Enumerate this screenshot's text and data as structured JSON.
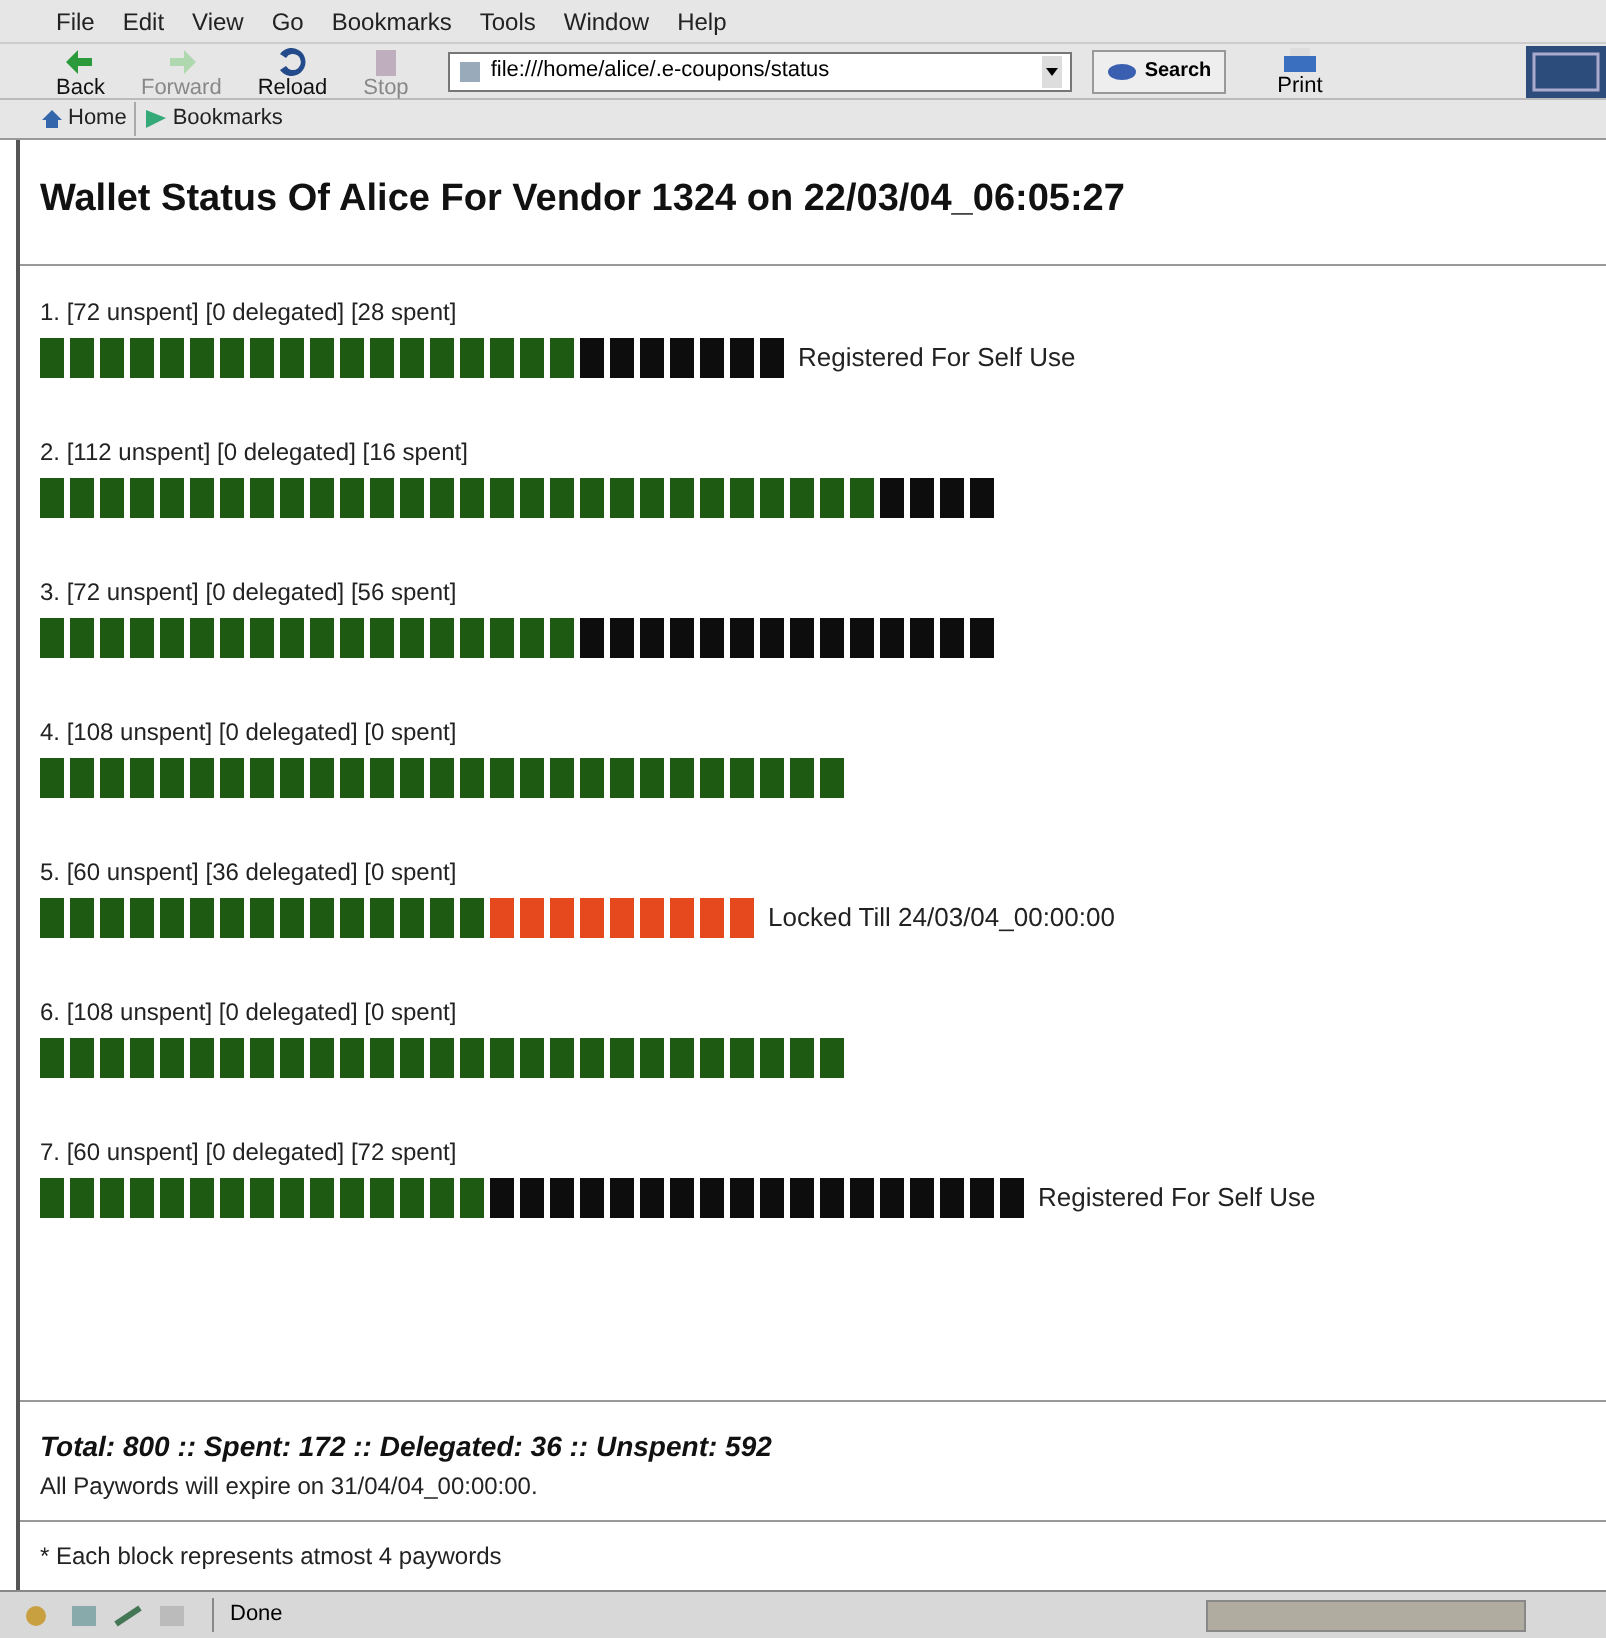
{
  "menu_bar": [
    "File",
    "Edit",
    "View",
    "Go",
    "Bookmarks",
    "Tools",
    "Window",
    "Help"
  ],
  "toolbar": {
    "buttons": [
      {
        "label": "Back",
        "kind": "back",
        "disabled": false
      },
      {
        "label": "Forward",
        "kind": "forward",
        "disabled": true
      },
      {
        "label": "Reload",
        "kind": "reload",
        "disabled": false
      },
      {
        "label": "Stop",
        "kind": "stop",
        "disabled": true
      }
    ],
    "address": "file:///home/alice/.e-coupons/status",
    "search": "Search",
    "print": "Print"
  },
  "bookmarks_bar": [
    "Home",
    "Bookmarks"
  ],
  "page": {
    "title": "Wallet Status Of Alice For Vendor 1324 on 22/03/04_06:05:27",
    "wallets": [
      {
        "summary": "1. [72 unspent] [0 delegated] [28 spent]",
        "bar": [
          {
            "kind": "unspent"
          },
          {
            "kind": "unspent"
          },
          {
            "kind": "unspent"
          },
          {
            "kind": "unspent"
          },
          {
            "kind": "unspent"
          },
          {
            "kind": "unspent"
          },
          {
            "kind": "unspent"
          },
          {
            "kind": "unspent"
          },
          {
            "kind": "unspent"
          },
          {
            "kind": "unspent"
          },
          {
            "kind": "unspent"
          },
          {
            "kind": "unspent"
          },
          {
            "kind": "unspent"
          },
          {
            "kind": "unspent"
          },
          {
            "kind": "unspent"
          },
          {
            "kind": "unspent"
          },
          {
            "kind": "unspent"
          },
          {
            "kind": "unspent"
          },
          {
            "kind": "spent"
          },
          {
            "kind": "spent"
          },
          {
            "kind": "spent"
          },
          {
            "kind": "spent"
          },
          {
            "kind": "spent"
          },
          {
            "kind": "spent"
          },
          {
            "kind": "spent"
          }
        ],
        "note": "Registered For Self Use"
      },
      {
        "summary": "2. [112 unspent] [0 delegated] [16 spent]",
        "bar": [
          {
            "kind": "unspent"
          },
          {
            "kind": "unspent"
          },
          {
            "kind": "unspent"
          },
          {
            "kind": "unspent"
          },
          {
            "kind": "unspent"
          },
          {
            "kind": "unspent"
          },
          {
            "kind": "unspent"
          },
          {
            "kind": "unspent"
          },
          {
            "kind": "unspent"
          },
          {
            "kind": "unspent"
          },
          {
            "kind": "unspent"
          },
          {
            "kind": "unspent"
          },
          {
            "kind": "unspent"
          },
          {
            "kind": "unspent"
          },
          {
            "kind": "unspent"
          },
          {
            "kind": "unspent"
          },
          {
            "kind": "unspent"
          },
          {
            "kind": "unspent"
          },
          {
            "kind": "unspent"
          },
          {
            "kind": "unspent"
          },
          {
            "kind": "unspent"
          },
          {
            "kind": "unspent"
          },
          {
            "kind": "unspent"
          },
          {
            "kind": "unspent"
          },
          {
            "kind": "unspent"
          },
          {
            "kind": "unspent"
          },
          {
            "kind": "unspent"
          },
          {
            "kind": "unspent"
          },
          {
            "kind": "spent"
          },
          {
            "kind": "spent"
          },
          {
            "kind": "spent"
          },
          {
            "kind": "spent"
          }
        ]
      },
      {
        "summary": "3. [72 unspent] [0 delegated] [56 spent]",
        "bar": [
          {
            "kind": "unspent"
          },
          {
            "kind": "unspent"
          },
          {
            "kind": "unspent"
          },
          {
            "kind": "unspent"
          },
          {
            "kind": "unspent"
          },
          {
            "kind": "unspent"
          },
          {
            "kind": "unspent"
          },
          {
            "kind": "unspent"
          },
          {
            "kind": "unspent"
          },
          {
            "kind": "unspent"
          },
          {
            "kind": "unspent"
          },
          {
            "kind": "unspent"
          },
          {
            "kind": "unspent"
          },
          {
            "kind": "unspent"
          },
          {
            "kind": "unspent"
          },
          {
            "kind": "unspent"
          },
          {
            "kind": "unspent"
          },
          {
            "kind": "unspent"
          },
          {
            "kind": "spent"
          },
          {
            "kind": "spent"
          },
          {
            "kind": "spent"
          },
          {
            "kind": "spent"
          },
          {
            "kind": "spent"
          },
          {
            "kind": "spent"
          },
          {
            "kind": "spent"
          },
          {
            "kind": "spent"
          },
          {
            "kind": "spent"
          },
          {
            "kind": "spent"
          },
          {
            "kind": "spent"
          },
          {
            "kind": "spent"
          },
          {
            "kind": "spent"
          },
          {
            "kind": "spent"
          }
        ]
      },
      {
        "summary": "4. [108 unspent] [0 delegated] [0 spent]",
        "bar": [
          {
            "kind": "unspent"
          },
          {
            "kind": "unspent"
          },
          {
            "kind": "unspent"
          },
          {
            "kind": "unspent"
          },
          {
            "kind": "unspent"
          },
          {
            "kind": "unspent"
          },
          {
            "kind": "unspent"
          },
          {
            "kind": "unspent"
          },
          {
            "kind": "unspent"
          },
          {
            "kind": "unspent"
          },
          {
            "kind": "unspent"
          },
          {
            "kind": "unspent"
          },
          {
            "kind": "unspent"
          },
          {
            "kind": "unspent"
          },
          {
            "kind": "unspent"
          },
          {
            "kind": "unspent"
          },
          {
            "kind": "unspent"
          },
          {
            "kind": "unspent"
          },
          {
            "kind": "unspent"
          },
          {
            "kind": "unspent"
          },
          {
            "kind": "unspent"
          },
          {
            "kind": "unspent"
          },
          {
            "kind": "unspent"
          },
          {
            "kind": "unspent"
          },
          {
            "kind": "unspent"
          },
          {
            "kind": "unspent"
          },
          {
            "kind": "unspent"
          }
        ]
      },
      {
        "summary": "5. [60 unspent] [36 delegated] [0 spent]",
        "bar": [
          {
            "kind": "unspent"
          },
          {
            "kind": "unspent"
          },
          {
            "kind": "unspent"
          },
          {
            "kind": "unspent"
          },
          {
            "kind": "unspent"
          },
          {
            "kind": "unspent"
          },
          {
            "kind": "unspent"
          },
          {
            "kind": "unspent"
          },
          {
            "kind": "unspent"
          },
          {
            "kind": "unspent"
          },
          {
            "kind": "unspent"
          },
          {
            "kind": "unspent"
          },
          {
            "kind": "unspent"
          },
          {
            "kind": "unspent"
          },
          {
            "kind": "unspent"
          },
          {
            "kind": "delegated"
          },
          {
            "kind": "delegated"
          },
          {
            "kind": "delegated"
          },
          {
            "kind": "delegated"
          },
          {
            "kind": "delegated"
          },
          {
            "kind": "delegated"
          },
          {
            "kind": "delegated"
          },
          {
            "kind": "delegated"
          },
          {
            "kind": "delegated"
          }
        ],
        "note": "Locked Till 24/03/04_00:00:00"
      },
      {
        "summary": "6. [108 unspent] [0 delegated] [0 spent]",
        "bar": [
          {
            "kind": "unspent"
          },
          {
            "kind": "unspent"
          },
          {
            "kind": "unspent"
          },
          {
            "kind": "unspent"
          },
          {
            "kind": "unspent"
          },
          {
            "kind": "unspent"
          },
          {
            "kind": "unspent"
          },
          {
            "kind": "unspent"
          },
          {
            "kind": "unspent"
          },
          {
            "kind": "unspent"
          },
          {
            "kind": "unspent"
          },
          {
            "kind": "unspent"
          },
          {
            "kind": "unspent"
          },
          {
            "kind": "unspent"
          },
          {
            "kind": "unspent"
          },
          {
            "kind": "unspent"
          },
          {
            "kind": "unspent"
          },
          {
            "kind": "unspent"
          },
          {
            "kind": "unspent"
          },
          {
            "kind": "unspent"
          },
          {
            "kind": "unspent"
          },
          {
            "kind": "unspent"
          },
          {
            "kind": "unspent"
          },
          {
            "kind": "unspent"
          },
          {
            "kind": "unspent"
          },
          {
            "kind": "unspent"
          },
          {
            "kind": "unspent"
          }
        ]
      },
      {
        "summary": "7. [60 unspent] [0 delegated] [72 spent]",
        "bar": [
          {
            "kind": "unspent"
          },
          {
            "kind": "unspent"
          },
          {
            "kind": "unspent"
          },
          {
            "kind": "unspent"
          },
          {
            "kind": "unspent"
          },
          {
            "kind": "unspent"
          },
          {
            "kind": "unspent"
          },
          {
            "kind": "unspent"
          },
          {
            "kind": "unspent"
          },
          {
            "kind": "unspent"
          },
          {
            "kind": "unspent"
          },
          {
            "kind": "unspent"
          },
          {
            "kind": "unspent"
          },
          {
            "kind": "unspent"
          },
          {
            "kind": "unspent"
          },
          {
            "kind": "spent"
          },
          {
            "kind": "spent"
          },
          {
            "kind": "spent"
          },
          {
            "kind": "spent"
          },
          {
            "kind": "spent"
          },
          {
            "kind": "spent"
          },
          {
            "kind": "spent"
          },
          {
            "kind": "spent"
          },
          {
            "kind": "spent"
          },
          {
            "kind": "spent"
          },
          {
            "kind": "spent"
          },
          {
            "kind": "spent"
          },
          {
            "kind": "spent"
          },
          {
            "kind": "spent"
          },
          {
            "kind": "spent"
          },
          {
            "kind": "spent"
          },
          {
            "kind": "spent"
          },
          {
            "kind": "spent"
          }
        ],
        "note": "Registered For Self Use"
      }
    ],
    "totals": "Total: 800 :: Spent: 172 :: Delegated: 36 :: Unspent: 592",
    "expiry": "All Paywords will expire on 31/04/04_00:00:00.",
    "footnote": "* Each block represents atmost 4 paywords"
  },
  "status_bar": {
    "text": "Done"
  }
}
